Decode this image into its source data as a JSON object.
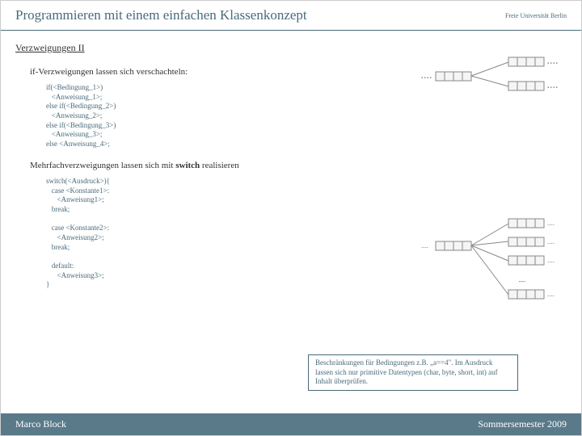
{
  "header": {
    "title": "Programmieren mit einem einfachen Klassenkonzept",
    "logo": "Freie Universität Berlin"
  },
  "section": {
    "title": "Verzweigungen II",
    "intro": "if-Verzweigungen lassen sich verschachteln:",
    "code1": "if(<Bedingung_1>)\n   <Anweisung_1>;\nelse if(<Bedingung_2>)\n   <Anweisung_2>;\nelse if(<Bedingung_3>)\n   <Anweisung_3>;\nelse <Anweisung_4>;",
    "mid_pre": "Mehrfachverzweigungen lassen sich mit ",
    "mid_bold": "switch",
    "mid_post": " realisieren",
    "code2": "switch(<Ausdruck>){\n   case <Konstante1>:\n      <Anweisung1>;\n   break;\n\n   case <Konstante2>:\n      <Anweisung2>;\n   break;\n\n   default:\n      <Anweisung3>;\n}",
    "note": "Beschränkungen für Bedingungen z.B. „a==4\". Im Ausdruck lassen sich nur primitive Datentypen (char, byte, short, int) auf Inhalt überprüfen."
  },
  "footer": {
    "author": "Marco Block",
    "term": "Sommersemester 2009"
  }
}
